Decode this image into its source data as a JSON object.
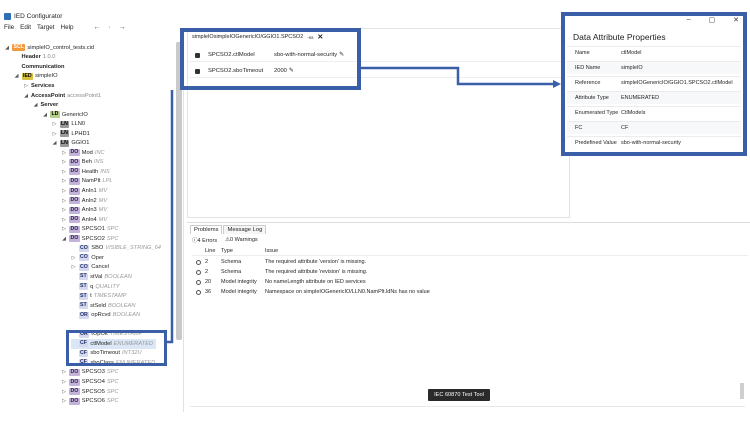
{
  "app": {
    "title": "IED Configurator"
  },
  "window": {
    "minimize": "–",
    "maximize": "▢",
    "close": "✕"
  },
  "menu": [
    "File",
    "Edit",
    "Target",
    "Help"
  ],
  "nav": {
    "back": "←",
    "sep": "·",
    "forward": "→"
  },
  "tree": [
    {
      "depth": 0,
      "twist": "◢",
      "badge": "SCL",
      "badge_type": "scl",
      "label": "simpleIO_control_tests.cid",
      "label_bold": false,
      "hint": ""
    },
    {
      "depth": 1,
      "twist": "",
      "badge": "",
      "badge_type": "",
      "label": "Header",
      "label_bold": true,
      "hint": "1.0.0"
    },
    {
      "depth": 1,
      "twist": "",
      "badge": "",
      "badge_type": "",
      "label": "Communication",
      "label_bold": true,
      "hint": ""
    },
    {
      "depth": 1,
      "twist": "◢",
      "badge": "IED",
      "badge_type": "ied",
      "label": "simpleIO",
      "label_bold": false,
      "hint": ""
    },
    {
      "depth": 2,
      "twist": "▷",
      "badge": "",
      "badge_type": "",
      "label": "Services",
      "label_bold": true,
      "hint": ""
    },
    {
      "depth": 2,
      "twist": "◢",
      "badge": "",
      "badge_type": "",
      "label": "AccessPoint",
      "label_bold": true,
      "hint": "accessPoint1"
    },
    {
      "depth": 3,
      "twist": "◢",
      "badge": "",
      "badge_type": "",
      "label": "Server",
      "label_bold": true,
      "hint": ""
    },
    {
      "depth": 4,
      "twist": "◢",
      "badge": "LD",
      "badge_type": "ld",
      "label": "GenericIO",
      "label_bold": false,
      "hint": ""
    },
    {
      "depth": 5,
      "twist": "▷",
      "badge": "LN",
      "badge_type": "ln",
      "label": "LLN0",
      "label_bold": false,
      "hint": ""
    },
    {
      "depth": 5,
      "twist": "▷",
      "badge": "LN",
      "badge_type": "ln",
      "label": "LPHD1",
      "label_bold": false,
      "hint": ""
    },
    {
      "depth": 5,
      "twist": "◢",
      "badge": "LN",
      "badge_type": "ln",
      "label": "GGIO1",
      "label_bold": false,
      "hint": ""
    },
    {
      "depth": 6,
      "twist": "▷",
      "badge": "DO",
      "badge_type": "do",
      "label": "Mod",
      "label_bold": false,
      "hint": "INC"
    },
    {
      "depth": 6,
      "twist": "▷",
      "badge": "DO",
      "badge_type": "do",
      "label": "Beh",
      "label_bold": false,
      "hint": "INS"
    },
    {
      "depth": 6,
      "twist": "▷",
      "badge": "DO",
      "badge_type": "do",
      "label": "Health",
      "label_bold": false,
      "hint": "INS"
    },
    {
      "depth": 6,
      "twist": "▷",
      "badge": "DO",
      "badge_type": "do",
      "label": "NamPlt",
      "label_bold": false,
      "hint": "LPL"
    },
    {
      "depth": 6,
      "twist": "▷",
      "badge": "DO",
      "badge_type": "do",
      "label": "AnIn1",
      "label_bold": false,
      "hint": "MV"
    },
    {
      "depth": 6,
      "twist": "▷",
      "badge": "DO",
      "badge_type": "do",
      "label": "AnIn2",
      "label_bold": false,
      "hint": "MV"
    },
    {
      "depth": 6,
      "twist": "▷",
      "badge": "DO",
      "badge_type": "do",
      "label": "AnIn3",
      "label_bold": false,
      "hint": "MV"
    },
    {
      "depth": 6,
      "twist": "▷",
      "badge": "DO",
      "badge_type": "do",
      "label": "AnIn4",
      "label_bold": false,
      "hint": "MV"
    },
    {
      "depth": 6,
      "twist": "▷",
      "badge": "DO",
      "badge_type": "do",
      "label": "SPCSO1",
      "label_bold": false,
      "hint": "SPC"
    },
    {
      "depth": 6,
      "twist": "◢",
      "badge": "DO",
      "badge_type": "do",
      "label": "SPCSO2",
      "label_bold": false,
      "hint": "SPC"
    },
    {
      "depth": 7,
      "twist": "",
      "badge": "CO",
      "badge_type": "da",
      "label": "SBO",
      "label_bold": false,
      "hint": "VISIBLE_STRING_64"
    },
    {
      "depth": 7,
      "twist": "▷",
      "badge": "CO",
      "badge_type": "da",
      "label": "Oper",
      "label_bold": false,
      "hint": ""
    },
    {
      "depth": 7,
      "twist": "▷",
      "badge": "CO",
      "badge_type": "da",
      "label": "Cancel",
      "label_bold": false,
      "hint": ""
    },
    {
      "depth": 7,
      "twist": "",
      "badge": "ST",
      "badge_type": "da",
      "label": "stVal",
      "label_bold": false,
      "hint": "BOOLEAN"
    },
    {
      "depth": 7,
      "twist": "",
      "badge": "ST",
      "badge_type": "da",
      "label": "q",
      "label_bold": false,
      "hint": "QUALITY"
    },
    {
      "depth": 7,
      "twist": "",
      "badge": "ST",
      "badge_type": "da",
      "label": "t",
      "label_bold": false,
      "hint": "TIMESTAMP"
    },
    {
      "depth": 7,
      "twist": "",
      "badge": "ST",
      "badge_type": "da",
      "label": "stSeld",
      "label_bold": false,
      "hint": "BOOLEAN"
    },
    {
      "depth": 7,
      "twist": "",
      "badge": "OR",
      "badge_type": "da",
      "label": "opRcvd",
      "label_bold": false,
      "hint": "BOOLEAN"
    },
    {
      "depth": 7,
      "twist": "",
      "badge": "",
      "badge_type": "",
      "label": "",
      "label_bold": false,
      "hint": ""
    },
    {
      "depth": 7,
      "twist": "",
      "badge": "OR",
      "badge_type": "da",
      "label": "tOpOk",
      "label_bold": false,
      "hint": "TIMESTAMP"
    },
    {
      "depth": 7,
      "twist": "",
      "badge": "CF",
      "badge_type": "da",
      "label": "ctlModel",
      "label_bold": false,
      "hint": "ENUMERATED",
      "selected": true
    },
    {
      "depth": 7,
      "twist": "",
      "badge": "CF",
      "badge_type": "da",
      "label": "sboTimeout",
      "label_bold": false,
      "hint": "INT32U"
    },
    {
      "depth": 7,
      "twist": "",
      "badge": "CF",
      "badge_type": "da",
      "label": "sboClass",
      "label_bold": false,
      "hint": "ENUMERATED"
    },
    {
      "depth": 6,
      "twist": "▷",
      "badge": "DO",
      "badge_type": "do",
      "label": "SPCSO3",
      "label_bold": false,
      "hint": "SPC"
    },
    {
      "depth": 6,
      "twist": "▷",
      "badge": "DO",
      "badge_type": "do",
      "label": "SPCSO4",
      "label_bold": false,
      "hint": "SPC"
    },
    {
      "depth": 6,
      "twist": "▷",
      "badge": "DO",
      "badge_type": "do",
      "label": "SPCSO5",
      "label_bold": false,
      "hint": "SPC"
    },
    {
      "depth": 6,
      "twist": "▷",
      "badge": "DO",
      "badge_type": "do",
      "label": "SPCSO6",
      "label_bold": false,
      "hint": "SPC"
    }
  ],
  "editor": {
    "tab_label": "simpleIOsimpleIOGenericIO/GGIO1.SPCSO2",
    "tab_badge": "-ss",
    "close": "✕",
    "edit_glyph": "✎",
    "rows": [
      {
        "name": "SPCSO2.ctlModel",
        "value": "sbo-with-normal-security"
      },
      {
        "name": "SPCSO2.sboTimeout",
        "value": "2000"
      }
    ]
  },
  "panel": {
    "tabs": [
      "Problems",
      "Message Log"
    ],
    "errors_label": "4 Errors",
    "warnings_label": "0 Warnings",
    "columns": [
      "Line",
      "Type",
      "Issue"
    ],
    "rows": [
      {
        "line": "2",
        "type": "Schema",
        "issue": "The required attribute 'version' is missing."
      },
      {
        "line": "2",
        "type": "Schema",
        "issue": "The required attribute 'revision' is missing."
      },
      {
        "line": "20",
        "type": "Model integrity",
        "issue": "No nameLength attribute on IED services"
      },
      {
        "line": "36",
        "type": "Model integrity",
        "issue": "Namespace on simpleIOGenericIO/LLN0.NamPlt.ldNs has no value"
      }
    ]
  },
  "dap": {
    "title": "Data Attribute Properties",
    "rows": [
      {
        "key": "Name",
        "value": "ctlModel"
      },
      {
        "key": "IED Name",
        "value": "simpleIO"
      },
      {
        "key": "Reference",
        "value": "simpleIOGenericIO/GGIO1.SPCSO2.ctlModel"
      },
      {
        "key": "Attribute Type",
        "value": "ENUMERATED"
      },
      {
        "key": "Enumerated Type",
        "value": "CtlModels"
      },
      {
        "key": "FC",
        "value": "CF"
      },
      {
        "key": "Predefined Value",
        "value": "sbo-with-normal-security"
      }
    ]
  },
  "tooltip": "IEC 60870 Test Tool",
  "colors": {
    "highlight": "#3a5ea8",
    "accent": "#2f6fb5"
  }
}
